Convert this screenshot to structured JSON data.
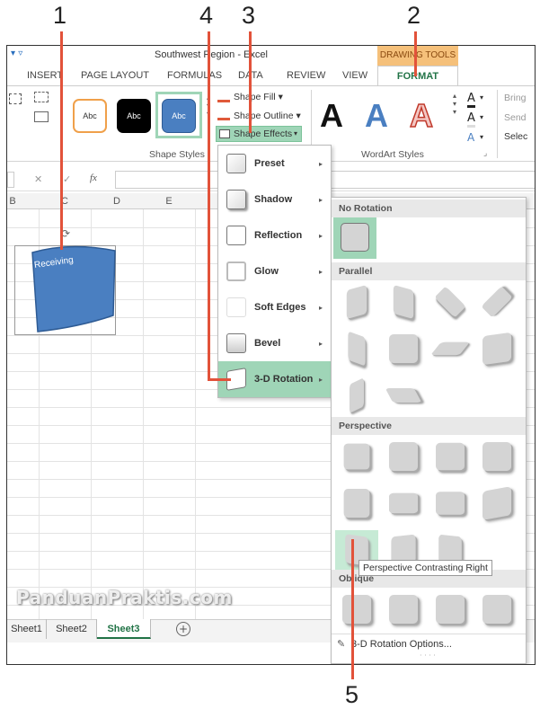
{
  "callouts": [
    "1",
    "2",
    "3",
    "4",
    "5"
  ],
  "title_bar": {
    "title": "Southwest Region - Excel",
    "context_tab_group": "DRAWING TOOLS"
  },
  "tabs": [
    "INSERT",
    "PAGE LAYOUT",
    "FORMULAS",
    "DATA",
    "REVIEW",
    "VIEW",
    "FORMAT"
  ],
  "active_tab": "FORMAT",
  "ribbon": {
    "shape_fill": "Shape Fill",
    "shape_outline": "Shape Outline",
    "shape_effects": "Shape Effects",
    "shape_styles_label": "Shape Styles",
    "wordart_label": "WordArt Styles",
    "style_swatch_text": "Abc",
    "wordart_letter": "A",
    "right_items": [
      "Bring",
      "Send",
      "Selec"
    ]
  },
  "formula_bar": {
    "cancel": "✕",
    "confirm": "✓",
    "fx": "fx"
  },
  "columns": [
    "B",
    "C",
    "D",
    "E"
  ],
  "shape": {
    "text": "Receiving",
    "fill": "#4a7fc1"
  },
  "effects_menu": {
    "items": [
      {
        "label": "Preset",
        "key": "P"
      },
      {
        "label": "Shadow",
        "key": "S"
      },
      {
        "label": "Reflection",
        "key": "R"
      },
      {
        "label": "Glow",
        "key": "G"
      },
      {
        "label": "Soft Edges",
        "key": "E"
      },
      {
        "label": "Bevel",
        "key": "B"
      },
      {
        "label": "3-D Rotation",
        "key": "D"
      }
    ],
    "active": "3-D Rotation"
  },
  "rotation_gallery": {
    "sections": [
      "No Rotation",
      "Parallel",
      "Perspective",
      "Oblique"
    ],
    "tooltip": "Perspective Contrasting Right",
    "options_link": "3-D Rotation Options..."
  },
  "sheet_tabs": [
    "Sheet1",
    "Sheet2",
    "Sheet3"
  ],
  "active_sheet": "Sheet3",
  "add_sheet": "+",
  "watermark": "PanduanPraktis.com",
  "colors": {
    "accent": "#217346",
    "callout_line": "#e2523a",
    "highlight": "#9fd5b7",
    "drawing_tools": "#f5c07a"
  }
}
